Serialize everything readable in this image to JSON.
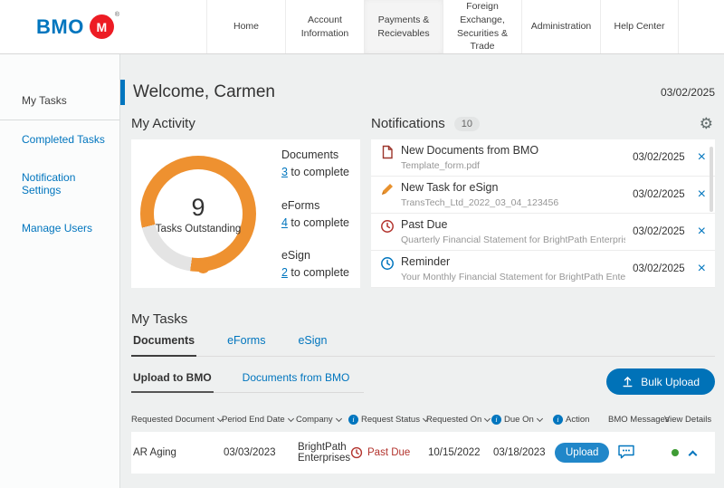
{
  "colors": {
    "brand_blue": "#0075be",
    "brand_red": "#ed1c24",
    "accent_orange": "#ee9130",
    "status_red": "#b3342e",
    "status_green": "#3f9c35"
  },
  "icons": {
    "gear": "⚙",
    "close": "×",
    "info": "i"
  },
  "header": {
    "logo_text": "BMO",
    "logo_mark": "M",
    "logo_reg": "®",
    "nav": [
      {
        "label": "Home"
      },
      {
        "label": "Account Information"
      },
      {
        "label": "Payments & Recievables",
        "active": true
      },
      {
        "label": "Foreign Exchange, Securities & Trade"
      },
      {
        "label": "Administration"
      },
      {
        "label": "Help Center"
      }
    ]
  },
  "sidebar": {
    "items": [
      {
        "label": "My Tasks",
        "active": true
      },
      {
        "label": "Completed Tasks"
      },
      {
        "label": "Notification Settings"
      },
      {
        "label": "Manage Users"
      }
    ]
  },
  "welcome": {
    "title": "Welcome, Carmen",
    "date": "03/02/2025"
  },
  "activity": {
    "title": "My Activity",
    "donut_count": "9",
    "donut_label": "Tasks Outstanding",
    "legend": [
      {
        "label": "Documents",
        "count": "3",
        "suffix": " to complete"
      },
      {
        "label": "eForms",
        "count": "4",
        "suffix": " to complete"
      },
      {
        "label": "eSign",
        "count": "2",
        "suffix": " to complete"
      }
    ]
  },
  "notifications": {
    "title": "Notifications",
    "count": "10",
    "items": [
      {
        "icon": "document-icon",
        "title": "New Documents from BMO",
        "subtitle": "Template_form.pdf",
        "date": "03/02/2025"
      },
      {
        "icon": "esign-pen-icon",
        "title": "New Task for eSign",
        "subtitle": "TransTech_Ltd_2022_03_04_123456",
        "date": "03/02/2025"
      },
      {
        "icon": "past-due-clock-icon",
        "title": "Past Due",
        "subtitle": "Quarterly Financial Statement for BrightPath Enterprises",
        "date": "03/02/2025"
      },
      {
        "icon": "reminder-clock-icon",
        "title": "Reminder",
        "subtitle": "Your Monthly Financial Statement for BrightPath Ente...",
        "date": "03/02/2025"
      }
    ]
  },
  "tasks": {
    "title": "My Tasks",
    "tabs": [
      {
        "label": "Documents",
        "active": true
      },
      {
        "label": "eForms"
      },
      {
        "label": "eSign"
      }
    ],
    "subtabs": [
      {
        "label": "Upload to BMO",
        "active": true
      },
      {
        "label": "Documents from BMO"
      }
    ],
    "bulk_upload_label": "Bulk Upload",
    "table": {
      "columns": [
        {
          "label": "Requested Document",
          "sortable": true
        },
        {
          "label": "Period End Date",
          "sortable": true
        },
        {
          "label": "Company",
          "sortable": true
        },
        {
          "label": "Request Status",
          "sortable": true,
          "info": true
        },
        {
          "label": "Requested On",
          "sortable": true
        },
        {
          "label": "Due On",
          "sortable": true,
          "info": true
        },
        {
          "label": "Action",
          "info": true
        },
        {
          "label": "BMO Messages"
        },
        {
          "label": "View Details"
        }
      ],
      "rows": [
        {
          "requested_document": "AR Aging",
          "period_end_date": "03/03/2023",
          "company": "BrightPath Enterprises",
          "request_status": "Past Due",
          "requested_on": "10/15/2022",
          "due_on": "03/18/2023",
          "action_label": "Upload"
        }
      ]
    }
  }
}
